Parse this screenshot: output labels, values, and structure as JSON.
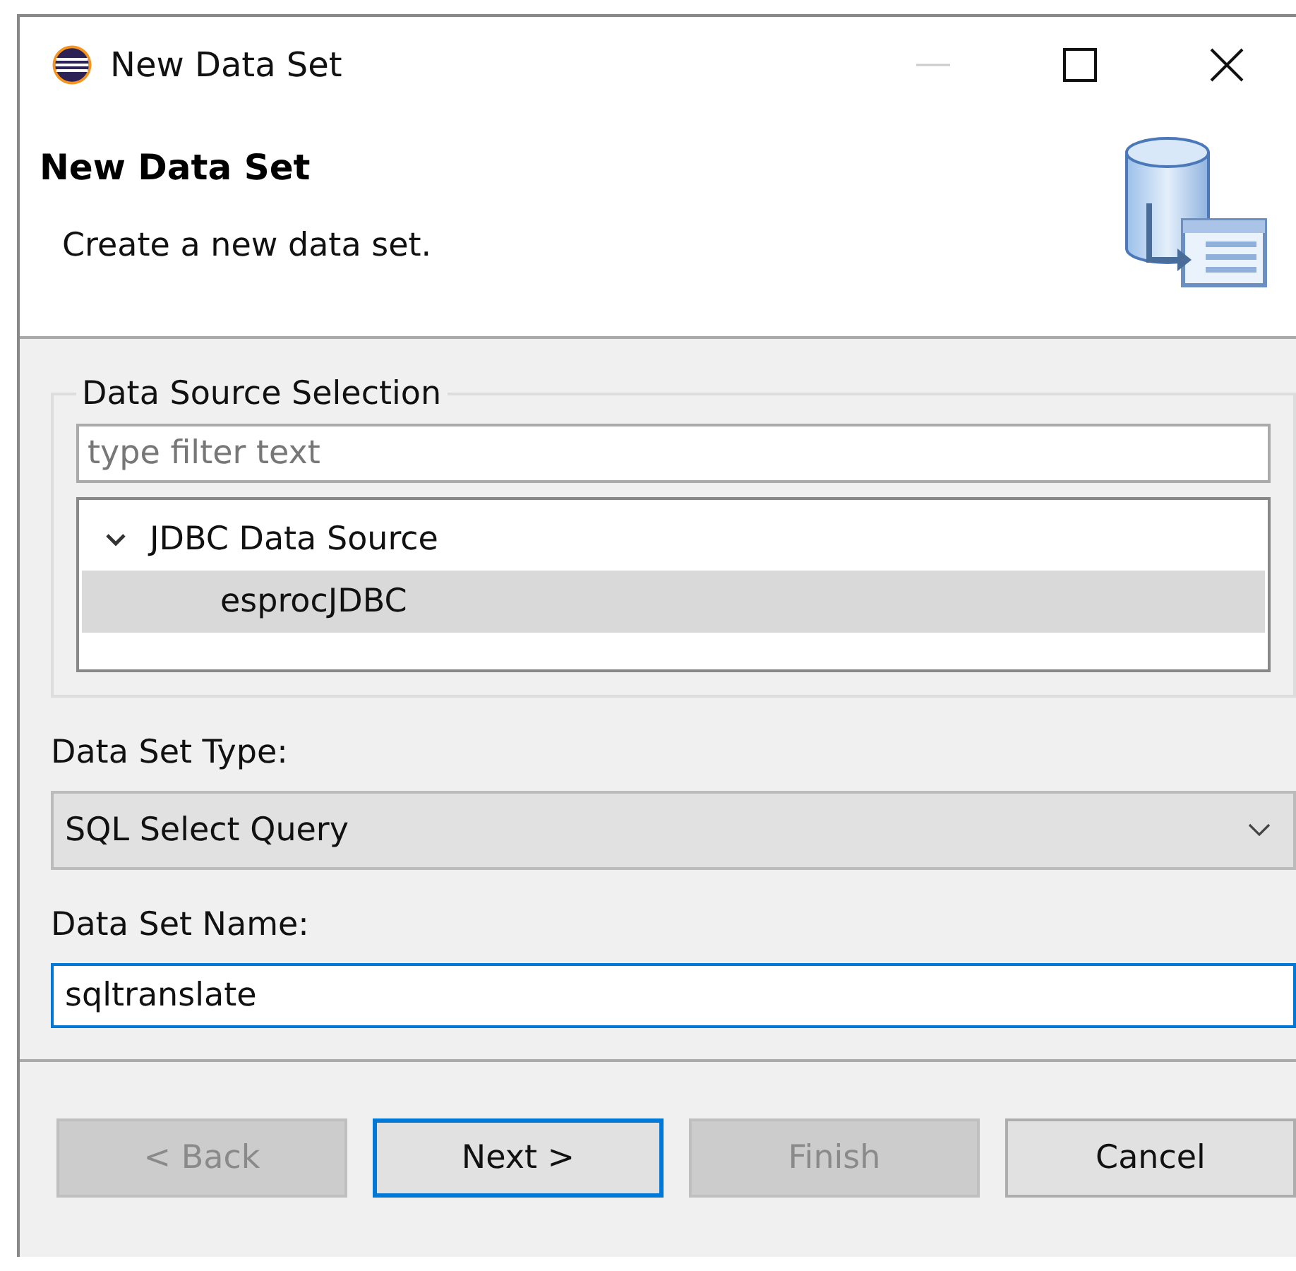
{
  "window": {
    "title": "New Data Set"
  },
  "header": {
    "title": "New Data Set",
    "description": "Create a new data set."
  },
  "data_source_selection": {
    "label": "Data Source Selection",
    "filter": {
      "placeholder": "type filter text"
    },
    "tree": [
      {
        "label": "JDBC Data Source",
        "expanded": true,
        "selected": false,
        "children": [
          {
            "label": "esprocJDBC",
            "selected": true
          }
        ]
      }
    ]
  },
  "data_set_type": {
    "label": "Data Set Type:",
    "value": "SQL Select Query"
  },
  "data_set_name": {
    "label": "Data Set Name:",
    "value": "sqltranslate",
    "focused": true
  },
  "buttons": [
    {
      "label": "< Back",
      "disabled": true,
      "default": false
    },
    {
      "label": "Next >",
      "disabled": false,
      "default": true
    },
    {
      "label": "Finish",
      "disabled": true,
      "default": false
    },
    {
      "label": "Cancel",
      "disabled": false,
      "default": false
    }
  ]
}
